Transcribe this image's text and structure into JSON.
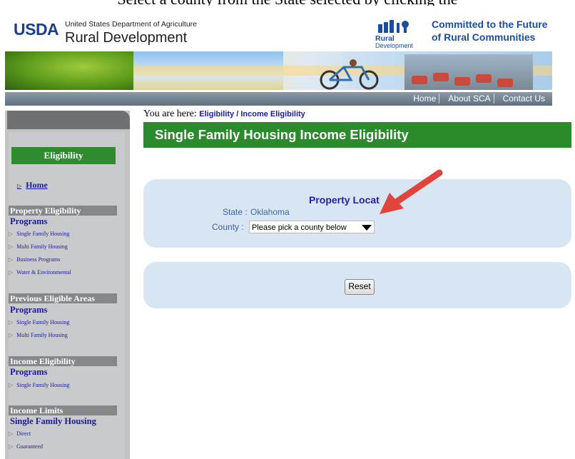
{
  "caption": "Select a county from the State selected by clicking the",
  "header": {
    "usda": "USDA",
    "department": "United States Department of Agriculture",
    "agency": "Rural Development",
    "rd_logo_line1": "Rural",
    "rd_logo_line2": "Development",
    "slogan_line1": "Committed to the Future",
    "slogan_line2": "of Rural Communities"
  },
  "nav": {
    "home": "Home",
    "about": "About SCA",
    "contact": "Contact Us"
  },
  "sidebar": {
    "eligibility_header": "Eligibility",
    "home": "Home",
    "sections": [
      {
        "heading": "Property Eligibility",
        "subheading": "Programs",
        "links": [
          "Single Family Housing",
          "Multi Family Housing",
          "Business Programs",
          "Water & Environmental"
        ]
      },
      {
        "heading": "Previous Eligible Areas",
        "subheading": "Programs",
        "links": [
          "Single Family Housing",
          "Multi Family Housing"
        ]
      },
      {
        "heading": "Income Eligibility",
        "subheading": "Programs",
        "links": [
          "Single Family Housing"
        ]
      },
      {
        "heading": "Income Limits",
        "subheading": "Single Family Housing",
        "links": [
          "Direct",
          "Guaranteed"
        ]
      }
    ]
  },
  "main": {
    "breadcrumb_prefix": "You are here:",
    "breadcrumb_path": "Eligibility / Income Eligibility",
    "title": "Single Family Housing Income Eligibility",
    "property_location": "Property Locat",
    "state_label": "State :",
    "state_value": "Oklahoma",
    "county_label": "County :",
    "county_value": "Please pick a county below",
    "reset_label": "Reset"
  },
  "colors": {
    "green": "#2b8a2b",
    "panel_blue": "#d8e5f2",
    "nav_gray": "#6f7f8e",
    "arrow_red": "#e0443a"
  }
}
